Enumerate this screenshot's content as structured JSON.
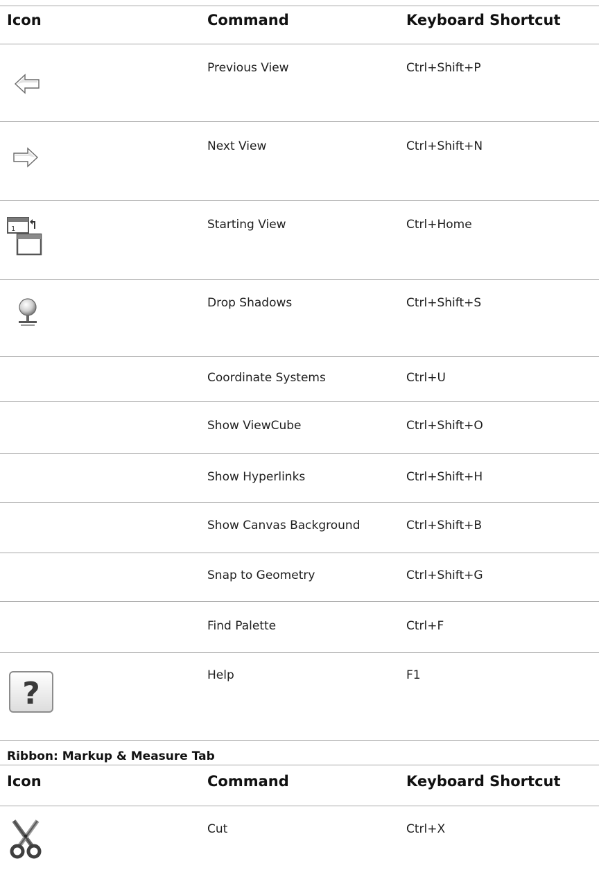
{
  "table1": {
    "headers": {
      "icon": "Icon",
      "command": "Command",
      "shortcut": "Keyboard Shortcut"
    },
    "rows": [
      {
        "icon": "previous-view-arrow-icon",
        "command": "Previous View",
        "shortcut": "Ctrl+Shift+P"
      },
      {
        "icon": "next-view-arrow-icon",
        "command": "Next View",
        "shortcut": "Ctrl+Shift+N"
      },
      {
        "icon": "starting-view-icon",
        "command": "Starting View",
        "shortcut": "Ctrl+Home"
      },
      {
        "icon": "drop-shadows-icon",
        "command": "Drop Shadows",
        "shortcut": "Ctrl+Shift+S"
      },
      {
        "icon": "",
        "command": "Coordinate Systems",
        "shortcut": "Ctrl+U"
      },
      {
        "icon": "",
        "command": "Show ViewCube",
        "shortcut": "Ctrl+Shift+O"
      },
      {
        "icon": "",
        "command": "Show Hyperlinks",
        "shortcut": "Ctrl+Shift+H"
      },
      {
        "icon": "",
        "command": "Show Canvas Background",
        "shortcut": "Ctrl+Shift+B"
      },
      {
        "icon": "",
        "command": "Snap to Geometry",
        "shortcut": "Ctrl+Shift+G"
      },
      {
        "icon": "",
        "command": "Find Palette",
        "shortcut": "Ctrl+F"
      },
      {
        "icon": "help-question-icon",
        "command": "Help",
        "shortcut": "F1"
      }
    ]
  },
  "section2": {
    "title": "Ribbon: Markup & Measure Tab",
    "headers": {
      "icon": "Icon",
      "command": "Command",
      "shortcut": "Keyboard Shortcut"
    },
    "rows": [
      {
        "icon": "scissors-cut-icon",
        "command": "Cut",
        "shortcut": "Ctrl+X"
      }
    ]
  }
}
